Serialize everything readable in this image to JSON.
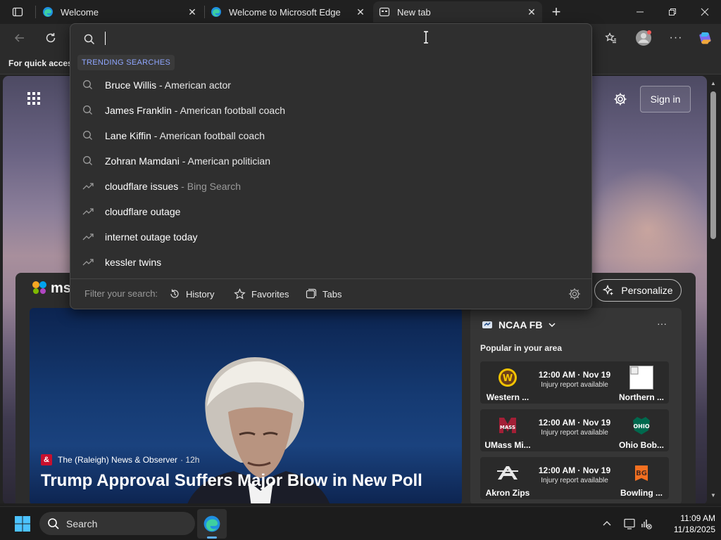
{
  "tabs": [
    {
      "title": "Welcome",
      "icon": "edge-icon"
    },
    {
      "title": "Welcome to Microsoft Edge",
      "icon": "edge-icon"
    },
    {
      "title": "New tab",
      "icon": "new-tab-page-icon"
    }
  ],
  "favorites_bar": {
    "text": "For quick access"
  },
  "omnibox": {
    "value": "",
    "trending_label": "TRENDING SEARCHES",
    "suggestions": [
      {
        "query": "Bruce Willis",
        "desc": "American actor",
        "icon": "search-icon"
      },
      {
        "query": "James Franklin",
        "desc": "American football coach",
        "icon": "search-icon"
      },
      {
        "query": "Lane Kiffin",
        "desc": "American football coach",
        "icon": "search-icon"
      },
      {
        "query": "Zohran Mamdani",
        "desc": "American politician",
        "icon": "search-icon"
      },
      {
        "query": "cloudflare issues",
        "desc": "Bing Search",
        "icon": "trending-icon"
      },
      {
        "query": "cloudflare outage",
        "desc": "",
        "icon": "trending-icon"
      },
      {
        "query": "internet outage today",
        "desc": "",
        "icon": "trending-icon"
      },
      {
        "query": "kessler twins",
        "desc": "",
        "icon": "trending-icon"
      }
    ],
    "filter_label": "Filter your search:",
    "filters": [
      {
        "label": "History",
        "icon": "history-icon"
      },
      {
        "label": "Favorites",
        "icon": "star-icon"
      },
      {
        "label": "Tabs",
        "icon": "tabs-icon"
      }
    ]
  },
  "newtab": {
    "sign_in": "Sign in",
    "msn_text": "msn",
    "personalize": "Personalize",
    "hero": {
      "source_logo": "&",
      "source": "The (Raleigh) News & Observer",
      "time": "12h",
      "title": "Trump Approval Suffers Major Blow in New Poll"
    },
    "sports": {
      "league": "NCAA FB",
      "more": "···",
      "subtitle": "Popular in your area",
      "games": [
        {
          "home": "Western ...",
          "away": "Northern ...",
          "time": "12:00 AM · Nov 19",
          "note": "Injury report available"
        },
        {
          "home": "UMass Mi...",
          "away": "Ohio Bob...",
          "time": "12:00 AM · Nov 19",
          "note": "Injury report available"
        },
        {
          "home": "Akron Zips",
          "away": "Bowling ...",
          "time": "12:00 AM · Nov 19",
          "note": "Injury report available"
        }
      ]
    }
  },
  "taskbar": {
    "search_text": "Search",
    "time": "11:09 AM",
    "date": "11/18/2025"
  },
  "colors": {
    "accent": "#8fa6ff",
    "indicator": "#5eb0ff"
  }
}
